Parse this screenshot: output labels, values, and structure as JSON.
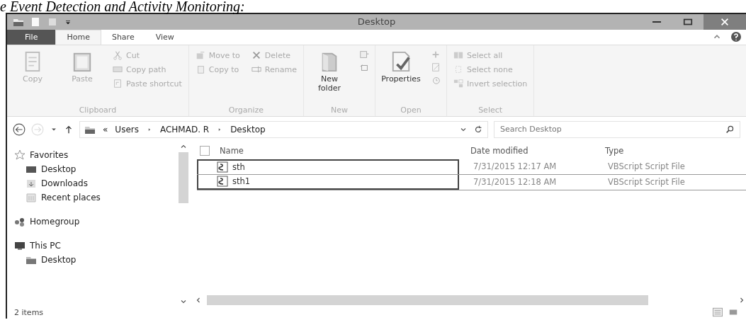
{
  "caption": "e Event Detection and Activity Monitoring:",
  "window": {
    "title": "Desktop"
  },
  "tabs": [
    {
      "label": "File",
      "selected": false,
      "kind": "file"
    },
    {
      "label": "Home",
      "selected": true,
      "kind": "tab"
    },
    {
      "label": "Share",
      "selected": false,
      "kind": "tab"
    },
    {
      "label": "View",
      "selected": false,
      "kind": "tab"
    }
  ],
  "ribbon_groups": [
    {
      "label": "Clipboard",
      "large": [
        {
          "label": "Copy",
          "disabled": true
        },
        {
          "label": "Paste",
          "disabled": true
        }
      ],
      "small": [
        {
          "label": "Cut",
          "disabled": true
        },
        {
          "label": "Copy path",
          "disabled": true
        },
        {
          "label": "Paste shortcut",
          "disabled": true
        }
      ]
    },
    {
      "label": "Organize",
      "small": [
        {
          "label": "Move to",
          "disabled": true
        },
        {
          "label": "Copy to",
          "disabled": true
        }
      ],
      "small2": [
        {
          "label": "Delete",
          "disabled": true
        },
        {
          "label": "Rename",
          "disabled": true
        }
      ]
    },
    {
      "label": "New",
      "large": [
        {
          "label": "New folder",
          "disabled": false
        }
      ]
    },
    {
      "label": "Open",
      "large": [
        {
          "label": "Properties",
          "disabled": false
        }
      ]
    },
    {
      "label": "Select",
      "small": [
        {
          "label": "Select all",
          "disabled": true
        },
        {
          "label": "Select none",
          "disabled": true
        },
        {
          "label": "Invert selection",
          "disabled": true
        }
      ]
    }
  ],
  "address": {
    "overflow": "«",
    "crumbs": [
      "Users",
      "ACHMAD. R",
      "Desktop"
    ]
  },
  "search": {
    "placeholder": "Search Desktop"
  },
  "sidebar": {
    "groups": [
      {
        "label": "Favorites",
        "children": [
          {
            "label": "Desktop"
          },
          {
            "label": "Downloads"
          },
          {
            "label": "Recent places"
          }
        ]
      },
      {
        "label": "Homegroup"
      },
      {
        "label": "This PC",
        "children": [
          {
            "label": "Desktop"
          }
        ]
      }
    ]
  },
  "header_checkbox": {
    "checked": false
  },
  "columns": [
    "Name",
    "Date modified",
    "Type"
  ],
  "rows": [
    {
      "name": "sth",
      "date": "7/31/2015 12:17 AM",
      "type": "VBScript Script File",
      "framed": true
    },
    {
      "name": "sth1",
      "date": "7/31/2015 12:18 AM",
      "type": "VBScript Script File",
      "framed": true
    }
  ],
  "status_bar": {
    "text": "2 items"
  }
}
